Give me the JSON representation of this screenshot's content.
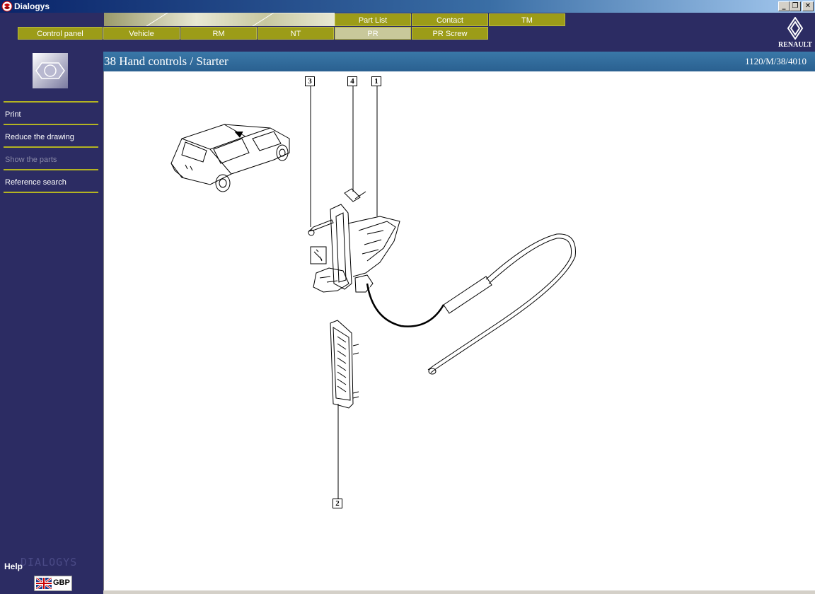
{
  "window": {
    "title": "Dialogys"
  },
  "nav": {
    "top_tabs": [
      {
        "label": "Part List"
      },
      {
        "label": "Contact"
      },
      {
        "label": "TM"
      }
    ],
    "main_tabs": [
      {
        "label": "Control panel"
      },
      {
        "label": "Vehicle"
      },
      {
        "label": "RM"
      },
      {
        "label": "NT"
      },
      {
        "label": "PR",
        "active": true
      },
      {
        "label": "PR Screw"
      }
    ]
  },
  "brand": {
    "logo": "RENAULT"
  },
  "sidebar": {
    "icon": "hex-bolt-icon",
    "items": [
      {
        "label": "Print",
        "enabled": true
      },
      {
        "label": "Reduce the drawing",
        "enabled": true
      },
      {
        "label": "Show the parts",
        "enabled": false
      },
      {
        "label": "Reference search",
        "enabled": true
      }
    ],
    "help_label": "Help",
    "watermark": "DIALOGYS",
    "language": "GBP"
  },
  "page": {
    "title": "38 Hand controls / Starter",
    "reference": "1120/M/38/4010"
  },
  "drawing": {
    "callouts": [
      "3",
      "4",
      "1",
      "2"
    ]
  },
  "colors": {
    "background": "#2c2c63",
    "tab_olive": "#9c9c18",
    "tab_active": "#c8c89a",
    "header_blue": "#2a6090",
    "separator": "#b3b322"
  }
}
